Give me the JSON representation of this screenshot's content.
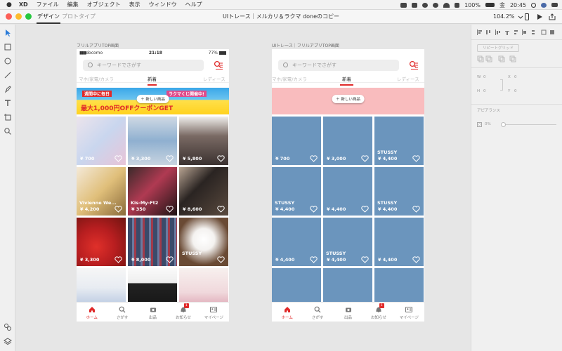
{
  "menubar": {
    "app": "XD",
    "items": [
      "ファイル",
      "編集",
      "オブジェクト",
      "表示",
      "ウィンドウ",
      "ヘルプ"
    ],
    "battery": "100%",
    "day": "金",
    "time": "20:45"
  },
  "titlebar": {
    "tab_design": "デザイン",
    "tab_prototype": "プロトタイプ",
    "title": "UIトレース｜メルカリ＆ラクマ doneのコピー",
    "zoom": "104.2%"
  },
  "colors": {
    "accent": "#e02a2a",
    "tile": "#6b95bd",
    "banner2": "#f9bcbe"
  },
  "artboards": [
    {
      "label": "フリルアプリTOP画面",
      "status": {
        "carrier": "docomo",
        "time": "21:18",
        "battery": "77%"
      },
      "search_placeholder": "キーワードでさがす",
      "tabs": {
        "left": "マホ/家電/カメラ",
        "active": "新着",
        "right": "レディース"
      },
      "banner": {
        "line1": "週間中に毎日",
        "line2": "ラクマくじ開催中!",
        "big": "最大1,000円OFFクーポンGET",
        "pill": "新しい商品"
      },
      "cells": [
        {
          "label": "",
          "price": "¥ 700"
        },
        {
          "label": "",
          "price": "¥ 3,300"
        },
        {
          "label": "",
          "price": "¥ 5,800"
        },
        {
          "label": "Vivienne We...",
          "price": "¥ 4,200"
        },
        {
          "label": "Kis-My-Ft2",
          "price": "¥ 350"
        },
        {
          "label": "",
          "price": "¥ 8,600"
        },
        {
          "label": "",
          "price": "¥ 3,300"
        },
        {
          "label": "",
          "price": "¥ 8,000"
        },
        {
          "label": "STUSSY",
          "price": ""
        },
        {
          "label": "",
          "price": ""
        },
        {
          "label": "",
          "price": ""
        },
        {
          "label": "",
          "price": ""
        }
      ],
      "nav": [
        "ホーム",
        "さがす",
        "出品",
        "お知らせ",
        "マイページ"
      ],
      "badge": "1"
    },
    {
      "label": "UIトレース｜フリルアプリTOP画面",
      "search_placeholder": "キーワードでさがす",
      "tabs": {
        "left": "マホ/家電/カメラ",
        "active": "新着",
        "right": "レディース"
      },
      "banner": {
        "pill": "新しい商品"
      },
      "cells": [
        {
          "label": "",
          "price": "¥ 700"
        },
        {
          "label": "",
          "price": "¥ 3,000"
        },
        {
          "label": "STUSSY",
          "price": "¥ 4,400"
        },
        {
          "label": "STUSSY",
          "price": "¥ 4,400"
        },
        {
          "label": "",
          "price": "¥ 4,400"
        },
        {
          "label": "STUSSY",
          "price": "¥ 4,400"
        },
        {
          "label": "",
          "price": "¥ 4,400"
        },
        {
          "label": "STUSSY",
          "price": "¥ 4,400"
        },
        {
          "label": "",
          "price": "¥ 4,400"
        },
        {
          "label": "",
          "price": ""
        },
        {
          "label": "",
          "price": ""
        },
        {
          "label": "",
          "price": ""
        }
      ],
      "nav": [
        "ホーム",
        "さがす",
        "出品",
        "お知らせ",
        "マイページ"
      ],
      "badge": "1"
    }
  ],
  "rightpanel": {
    "repeat_grid": "リピートグリッド",
    "w": "W",
    "w_val": "0",
    "x": "X",
    "x_val": "0",
    "h": "H",
    "h_val": "0",
    "y": "Y",
    "y_val": "0",
    "appearance": "アピアランス",
    "opacity": "0%"
  }
}
